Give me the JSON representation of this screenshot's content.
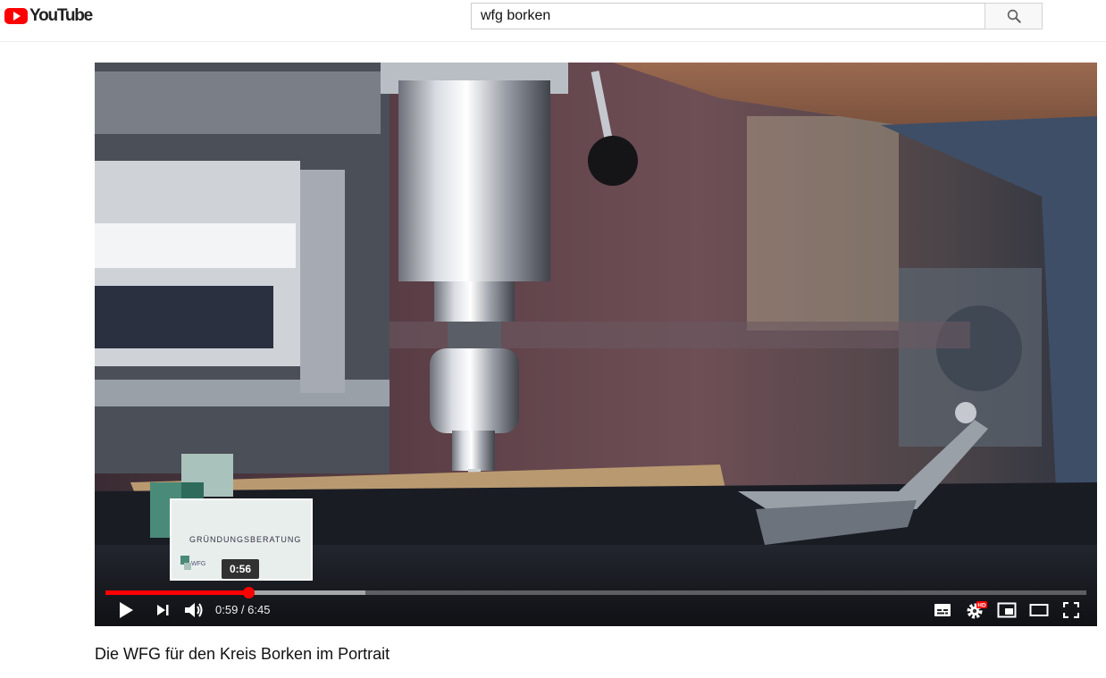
{
  "header": {
    "logo_text": "YouTube",
    "search": {
      "value": "wfg borken",
      "button_icon": "search-icon"
    }
  },
  "player": {
    "preview": {
      "title": "GRÜNDUNGSBERATUNG",
      "logo_text": "WFG",
      "hover_time": "0:56"
    },
    "progress": {
      "played_fraction": 0.146,
      "buffered_fraction": 0.265
    },
    "time": {
      "current": "0:59",
      "duration": "6:45",
      "display": "0:59 / 6:45"
    },
    "controls_left": [
      "play-icon",
      "next-icon",
      "volume-icon"
    ],
    "controls_right": [
      "subtitles-icon",
      "settings-icon",
      "miniplayer-icon",
      "theater-mode-icon",
      "fullscreen-icon"
    ],
    "settings_badge": "HD",
    "colors": {
      "progress": "#ff0000",
      "brand": "#ff0000"
    }
  },
  "video": {
    "title": "Die WFG für den Kreis Borken im Portrait"
  }
}
